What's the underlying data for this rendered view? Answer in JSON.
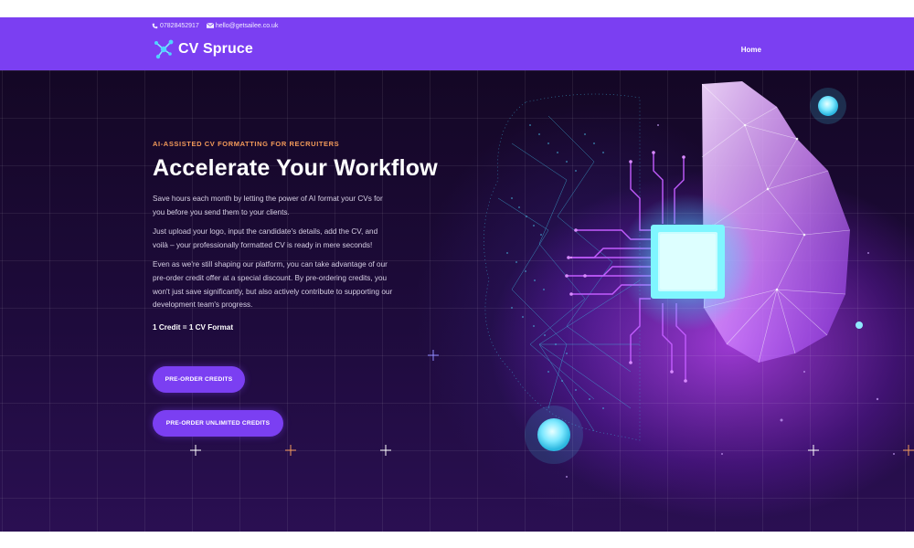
{
  "header": {
    "phone": "07828452917",
    "email": "hello@getsailee.co.uk",
    "brand": "CV Spruce",
    "nav": [
      {
        "label": "Home"
      }
    ]
  },
  "hero": {
    "eyebrow": "AI-ASSISTED CV FORMATTING FOR RECRUITERS",
    "title": "Accelerate Your Workflow",
    "paragraphs": [
      "Save hours each month by letting the power of AI format your CVs for you before you send them to your clients.",
      "Just upload your logo, input the candidate's details, add the CV, and voilà – your professionally formatted CV is ready in mere seconds!",
      "Even as we're still shaping our platform, you can take advantage of our pre-order credit offer at a special discount. By pre-ordering credits, you won't just save significantly, but also actively contribute to supporting our development team's progress."
    ],
    "credit_note": "1 Credit = 1 CV Format",
    "buttons": [
      {
        "label": "PRE-ORDER CREDITS"
      },
      {
        "label": "PRE-ORDER UNLIMITED CREDITS"
      }
    ]
  },
  "colors": {
    "brand_purple": "#7b3ff2",
    "eyebrow_orange": "#f39a5a",
    "hero_dark": "#140725"
  },
  "icons": [
    "phone-icon",
    "mail-icon",
    "logo-network-icon"
  ]
}
